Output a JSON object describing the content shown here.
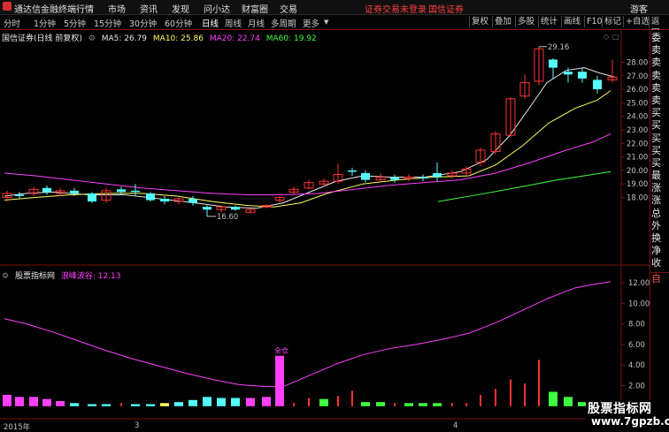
{
  "menubar": {
    "app_title": "通达信金融终端",
    "menus": [
      "行情",
      "市场",
      "资讯",
      "发现",
      "问小达",
      "财富圈",
      "交易"
    ],
    "notice": "证券交易未登录",
    "broker": "国信证券",
    "guest": "游客"
  },
  "toolbar": {
    "timeframes": [
      "分时",
      "1分钟",
      "5分钟",
      "15分钟",
      "30分钟",
      "60分钟",
      "日线",
      "周线",
      "月线",
      "多周期",
      "更多"
    ],
    "active_timeframe": "日线",
    "buttons": [
      "复权",
      "叠加",
      "多股",
      "统计",
      "画线",
      "F10",
      "标记",
      "+自选",
      "返回"
    ],
    "close_glyph": "×"
  },
  "main_chart": {
    "stock_label": "国信证券(日线 前复权)",
    "ma": [
      {
        "label": "MA5: 26.79",
        "color": "#e8e8e8"
      },
      {
        "label": "MA10: 25.86",
        "color": "#ffff60"
      },
      {
        "label": "MA20: 22.74",
        "color": "#ff40ff"
      },
      {
        "label": "MA60: 19.92",
        "color": "#40ff40"
      }
    ],
    "high_label": "29.16",
    "low_label": "16.60",
    "y_ticks": [
      "28.00",
      "27.00",
      "26.00",
      "25.00",
      "24.00",
      "23.00",
      "22.00",
      "21.00",
      "20.00",
      "19.00",
      "18.00"
    ]
  },
  "sub_chart": {
    "name_label": "股票指标网",
    "indicator_label": "浪峰波谷: 12.13",
    "signal_label": "全仓",
    "y_ticks": [
      "12.00",
      "10.00",
      "8.00",
      "6.00",
      "4.00",
      "2.00"
    ]
  },
  "x_axis": {
    "labels": [
      "2015年",
      "3",
      "4"
    ]
  },
  "right_panel": {
    "items": [
      "委比",
      "卖五",
      "卖四",
      "卖三",
      "卖二",
      "卖一",
      "买一",
      "买二",
      "买三",
      "买四",
      "买五",
      "最新",
      "涨跌",
      "涨幅",
      "总量",
      "外盘",
      "换手",
      "净资",
      "收益"
    ],
    "bottom_button": "自动"
  },
  "watermark": {
    "title": "股票指标网",
    "url": "www.7gpzb.com"
  },
  "colors": {
    "up": "#ff3232",
    "down": "#54fcfc",
    "ma5": "#e8e8e8",
    "ma10": "#ffff60",
    "ma20": "#ff40ff",
    "ma60": "#40ff40",
    "indicator": "#ff40ff",
    "signal": "#ff40ff",
    "grid": "#7a1010",
    "axis_text": "#c0c0c0"
  }
}
